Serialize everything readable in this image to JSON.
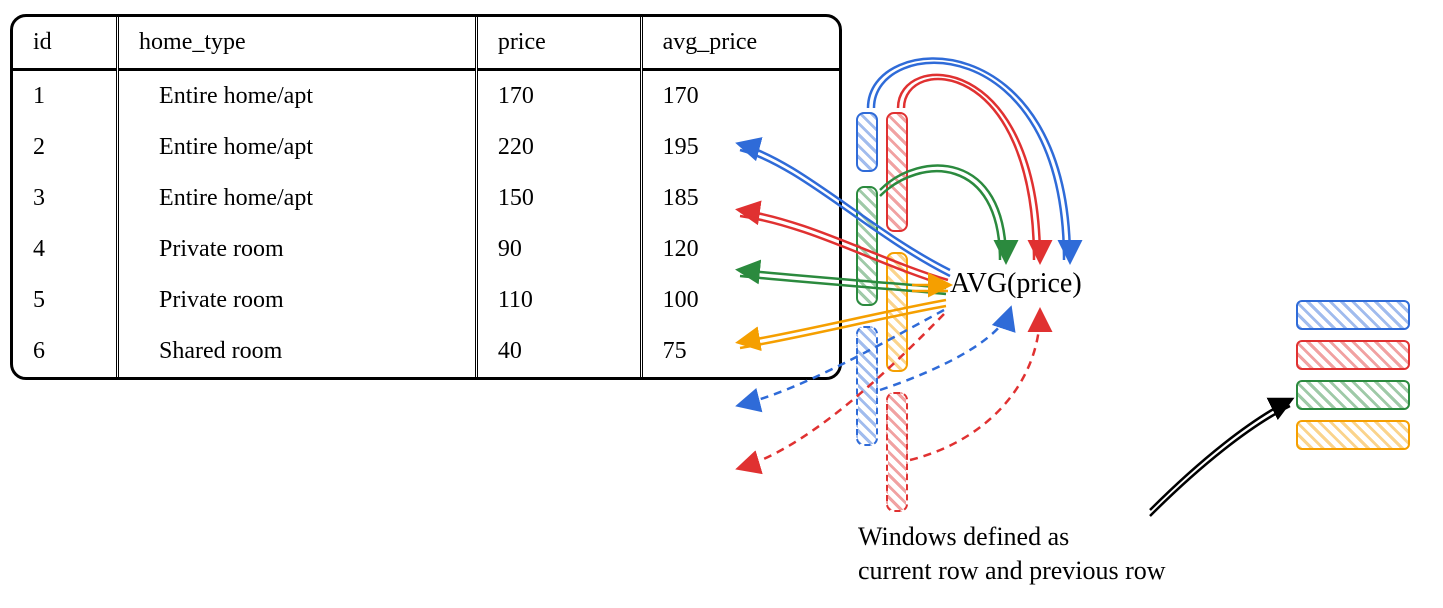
{
  "chart_data": {
    "type": "table",
    "columns": [
      "id",
      "home_type",
      "price",
      "avg_price"
    ],
    "rows": [
      {
        "id": 1,
        "home_type": "Entire home/apt",
        "price": 170,
        "avg_price": 170
      },
      {
        "id": 2,
        "home_type": "Entire home/apt",
        "price": 220,
        "avg_price": 195
      },
      {
        "id": 3,
        "home_type": "Entire home/apt",
        "price": 150,
        "avg_price": 185
      },
      {
        "id": 4,
        "home_type": "Private room",
        "price": 90,
        "avg_price": 120
      },
      {
        "id": 5,
        "home_type": "Private room",
        "price": 110,
        "avg_price": 100
      },
      {
        "id": 6,
        "home_type": "Shared room",
        "price": 40,
        "avg_price": 75
      }
    ],
    "annotations": {
      "function_label": "AVG(price)",
      "caption_line1": "Windows defined as",
      "caption_line2": "current row and previous row"
    }
  },
  "headers": {
    "id": "id",
    "home_type": "home_type",
    "price": "price",
    "avg_price": "avg_price"
  },
  "colors": {
    "blue": "#2f6bd8",
    "red": "#e03131",
    "green": "#2b8a3e",
    "orange": "#f59f00",
    "black": "#000000"
  }
}
